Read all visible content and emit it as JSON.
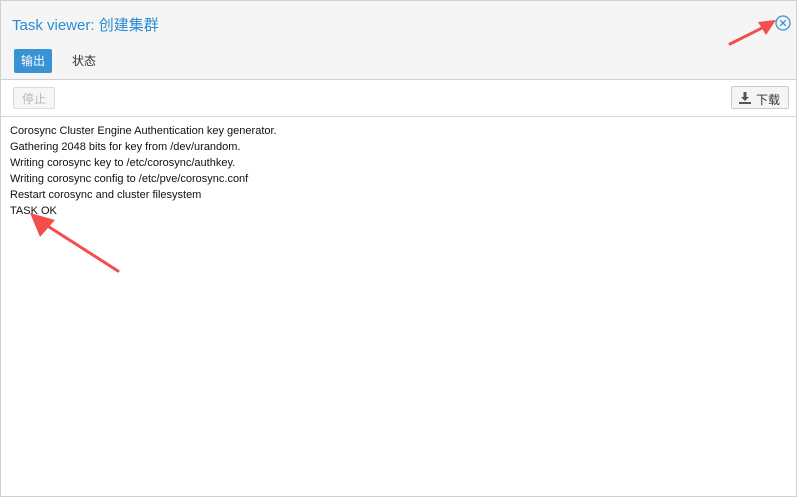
{
  "window": {
    "title": "Task viewer: 创建集群"
  },
  "tabs": [
    {
      "label": "输出",
      "active": true
    },
    {
      "label": "状态",
      "active": false
    }
  ],
  "toolbar": {
    "stop_label": "停止",
    "download_label": "下载"
  },
  "log": {
    "lines": [
      "Corosync Cluster Engine Authentication key generator.",
      "Gathering 2048 bits for key from /dev/urandom.",
      "Writing corosync key to /etc/corosync/authkey.",
      "Writing corosync config to /etc/pve/corosync.conf",
      "Restart corosync and cluster filesystem",
      "TASK OK"
    ]
  },
  "colors": {
    "accent": "#3892d4",
    "title": "#2a8ad4",
    "annotation_arrow": "#f24e4e"
  },
  "icons": {
    "close": "close-circle-icon",
    "download": "download-icon"
  }
}
